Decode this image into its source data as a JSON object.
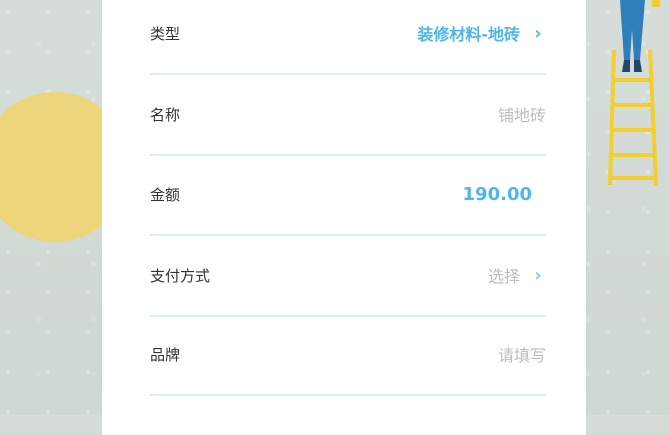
{
  "form": {
    "rows": [
      {
        "label": "类型",
        "value": "装修材料-地砖",
        "value_style": "accent",
        "has_chevron": true
      },
      {
        "label": "名称",
        "value": "铺地砖",
        "value_style": "placeholder",
        "has_chevron": false
      },
      {
        "label": "金额",
        "value": "190.00",
        "value_style": "accent",
        "has_chevron": false
      },
      {
        "label": "支付方式",
        "value": "选择",
        "value_style": "placeholder",
        "has_chevron": true
      },
      {
        "label": "品牌",
        "value": "请填写",
        "value_style": "placeholder",
        "has_chevron": false
      }
    ]
  },
  "icons": {
    "chevron": "chevron-right-icon"
  },
  "colors": {
    "accent": "#4fb6ea",
    "divider": "#d7eefb",
    "placeholder": "#bdbdbd",
    "label": "#333333",
    "background": "#d5dcd7",
    "sun": "#efd57a"
  }
}
